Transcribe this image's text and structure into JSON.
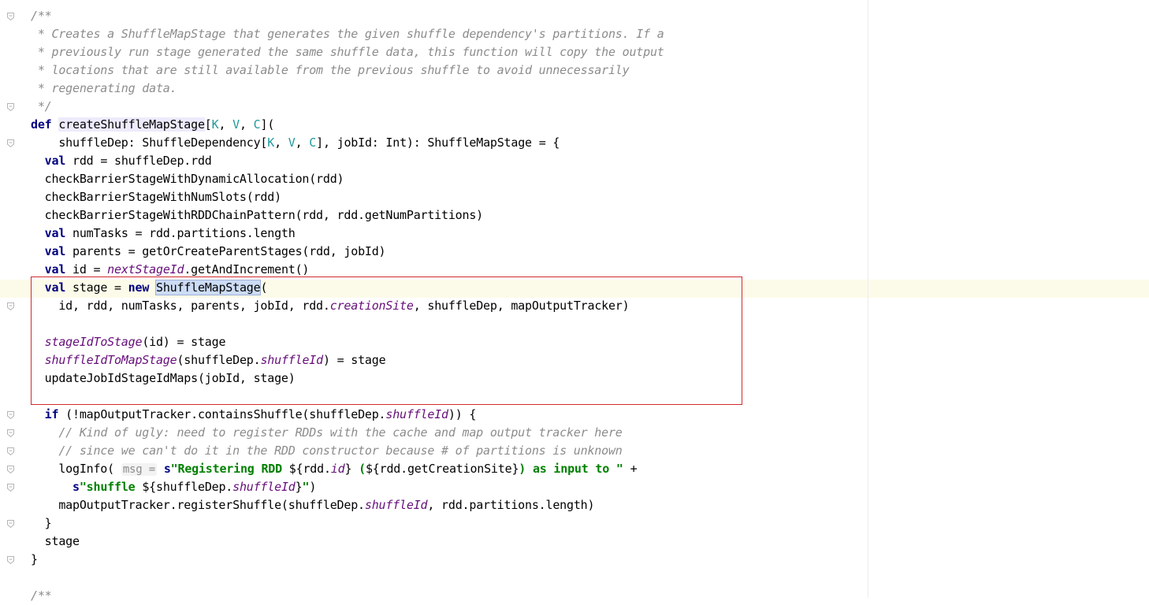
{
  "editor": {
    "language": "scala",
    "lines": [
      [
        {
          "t": "/**",
          "c": "doc"
        }
      ],
      [
        {
          "t": " * Creates a ShuffleMapStage that generates the given shuffle dependency's partitions. If a",
          "c": "doc"
        }
      ],
      [
        {
          "t": " * previously run stage generated the same shuffle data, this function will copy the output",
          "c": "doc"
        }
      ],
      [
        {
          "t": " * locations that are still available from the previous shuffle to avoid unnecessarily",
          "c": "doc"
        }
      ],
      [
        {
          "t": " * regenerating data.",
          "c": "doc"
        }
      ],
      [
        {
          "t": " */",
          "c": "doc"
        }
      ],
      [
        {
          "t": "def",
          "c": "kw"
        },
        {
          "t": " "
        },
        {
          "t": "createShuffleMapStage",
          "c": "hl-def"
        },
        {
          "t": "["
        },
        {
          "t": "K",
          "c": "tp"
        },
        {
          "t": ", "
        },
        {
          "t": "V",
          "c": "tp"
        },
        {
          "t": ", "
        },
        {
          "t": "C",
          "c": "tp"
        },
        {
          "t": "]("
        }
      ],
      [
        {
          "t": "    shuffleDep: ShuffleDependency["
        },
        {
          "t": "K",
          "c": "tp"
        },
        {
          "t": ", "
        },
        {
          "t": "V",
          "c": "tp"
        },
        {
          "t": ", "
        },
        {
          "t": "C",
          "c": "tp"
        },
        {
          "t": "], jobId: Int): ShuffleMapStage = {"
        }
      ],
      [
        {
          "t": "  "
        },
        {
          "t": "val",
          "c": "kw"
        },
        {
          "t": " rdd = shuffleDep.rdd"
        }
      ],
      [
        {
          "t": "  checkBarrierStageWithDynamicAllocation(rdd)"
        }
      ],
      [
        {
          "t": "  checkBarrierStageWithNumSlots(rdd)"
        }
      ],
      [
        {
          "t": "  checkBarrierStageWithRDDChainPattern(rdd, rdd.getNumPartitions)"
        }
      ],
      [
        {
          "t": "  "
        },
        {
          "t": "val",
          "c": "kw"
        },
        {
          "t": " numTasks = rdd.partitions.length"
        }
      ],
      [
        {
          "t": "  "
        },
        {
          "t": "val",
          "c": "kw"
        },
        {
          "t": " parents = getOrCreateParentStages(rdd, jobId)"
        }
      ],
      [
        {
          "t": "  "
        },
        {
          "t": "val",
          "c": "kw"
        },
        {
          "t": " id = "
        },
        {
          "t": "nextStageId",
          "c": "fld"
        },
        {
          "t": ".getAndIncrement()"
        }
      ],
      [
        {
          "t": "  "
        },
        {
          "t": "val",
          "c": "kw"
        },
        {
          "t": " stage = "
        },
        {
          "t": "new",
          "c": "kw"
        },
        {
          "t": " "
        },
        {
          "t": "ShuffleMapStage",
          "c": "hl-sel"
        },
        {
          "t": "("
        }
      ],
      [
        {
          "t": "    id, rdd, numTasks, parents, jobId, rdd."
        },
        {
          "t": "creationSite",
          "c": "fld"
        },
        {
          "t": ", shuffleDep, mapOutputTracker)"
        }
      ],
      [],
      [
        {
          "t": "  "
        },
        {
          "t": "stageIdToStage",
          "c": "fld"
        },
        {
          "t": "(id) = stage"
        }
      ],
      [
        {
          "t": "  "
        },
        {
          "t": "shuffleIdToMapStage",
          "c": "fld"
        },
        {
          "t": "(shuffleDep."
        },
        {
          "t": "shuffleId",
          "c": "fld"
        },
        {
          "t": ") = stage"
        }
      ],
      [
        {
          "t": "  updateJobIdStageIdMaps(jobId, stage)"
        }
      ],
      [],
      [
        {
          "t": "  "
        },
        {
          "t": "if",
          "c": "kw"
        },
        {
          "t": " (!mapOutputTracker.containsShuffle(shuffleDep."
        },
        {
          "t": "shuffleId",
          "c": "fld"
        },
        {
          "t": ")) {"
        }
      ],
      [
        {
          "t": "    "
        },
        {
          "t": "// Kind of ugly: need to register RDDs with the cache and map output tracker here",
          "c": "doc"
        }
      ],
      [
        {
          "t": "    "
        },
        {
          "t": "// since we can't do it in the RDD constructor because # of partitions is unknown",
          "c": "doc"
        }
      ],
      [
        {
          "t": "    logInfo( "
        },
        {
          "t": "msg =",
          "c": "hint"
        },
        {
          "t": " "
        },
        {
          "t": "s",
          "c": "kw"
        },
        {
          "t": "\"Registering RDD ",
          "c": "str"
        },
        {
          "t": "${"
        },
        {
          "t": "rdd."
        },
        {
          "t": "id",
          "c": "fld"
        },
        {
          "t": "}"
        },
        {
          "t": " (",
          "c": "str"
        },
        {
          "t": "${"
        },
        {
          "t": "rdd.getCreationSite"
        },
        {
          "t": "}"
        },
        {
          "t": ") as input to \"",
          "c": "str"
        },
        {
          "t": " +"
        }
      ],
      [
        {
          "t": "      "
        },
        {
          "t": "s",
          "c": "kw"
        },
        {
          "t": "\"shuffle ",
          "c": "str"
        },
        {
          "t": "${"
        },
        {
          "t": "shuffleDep."
        },
        {
          "t": "shuffleId",
          "c": "fld"
        },
        {
          "t": "}"
        },
        {
          "t": "\"",
          "c": "str"
        },
        {
          "t": ")"
        }
      ],
      [
        {
          "t": "    mapOutputTracker.registerShuffle(shuffleDep."
        },
        {
          "t": "shuffleId",
          "c": "fld"
        },
        {
          "t": ", rdd.partitions.length)"
        }
      ],
      [
        {
          "t": "  }"
        }
      ],
      [
        {
          "t": "  stage"
        }
      ],
      [
        {
          "t": "}"
        }
      ],
      [],
      [
        {
          "t": "/**",
          "c": "doc"
        }
      ]
    ],
    "fold_markers_at_lines": [
      0,
      5,
      7,
      15,
      16,
      22,
      23,
      24,
      25,
      26,
      28,
      30
    ]
  }
}
